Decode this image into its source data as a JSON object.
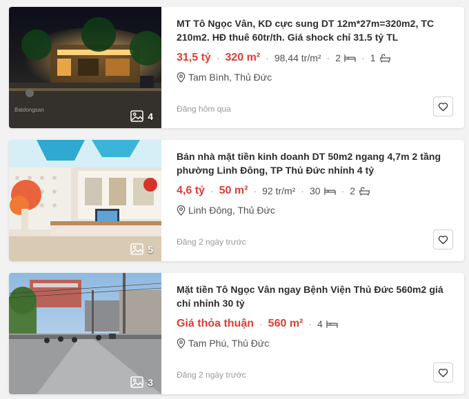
{
  "listings": [
    {
      "title": "MT Tô Ngọc Vân, KD cực sung DT 12m*27m=320m2, TC 210m2. HĐ thuê 60tr/th. Giá shock chỉ 31.5 tỷ TL",
      "price": "31,5 tỷ",
      "area": "320 m²",
      "price_per_m2": "98,44 tr/m²",
      "bedrooms": "2",
      "bathrooms": "1",
      "location": "Tam Bình, Thủ Đức",
      "posted": "Đăng hôm qua",
      "image_count": "4",
      "watermark": "Batdongsan"
    },
    {
      "title": "Bán nhà mặt tiền kinh doanh DT 50m2 ngang 4,7m 2 tầng phường Linh Đông, TP Thủ Đức nhỉnh 4 tỷ",
      "price": "4,6 tỷ",
      "area": "50 m²",
      "price_per_m2": "92 tr/m²",
      "bedrooms": "30",
      "bathrooms": "2",
      "location": "Linh Đông, Thủ Đức",
      "posted": "Đăng 2 ngày trước",
      "image_count": "5"
    },
    {
      "title": "Mặt tiền Tô Ngọc Vân ngay Bệnh Viện Thủ Đức 560m2 giá chỉ nhỉnh 30 tỷ",
      "price": "Giá thỏa thuận",
      "area": "560 m²",
      "bedrooms": "4",
      "location": "Tam Phú, Thủ Đức",
      "posted": "Đăng 2 ngày trước",
      "image_count": "3"
    }
  ],
  "icons": {
    "image": "image-icon",
    "bed": "bed-icon",
    "bath": "bath-icon",
    "location": "location-pin-icon",
    "heart": "heart-icon"
  },
  "colors": {
    "price": "#e03c31",
    "text": "#2c2c2c",
    "muted": "#999999"
  }
}
